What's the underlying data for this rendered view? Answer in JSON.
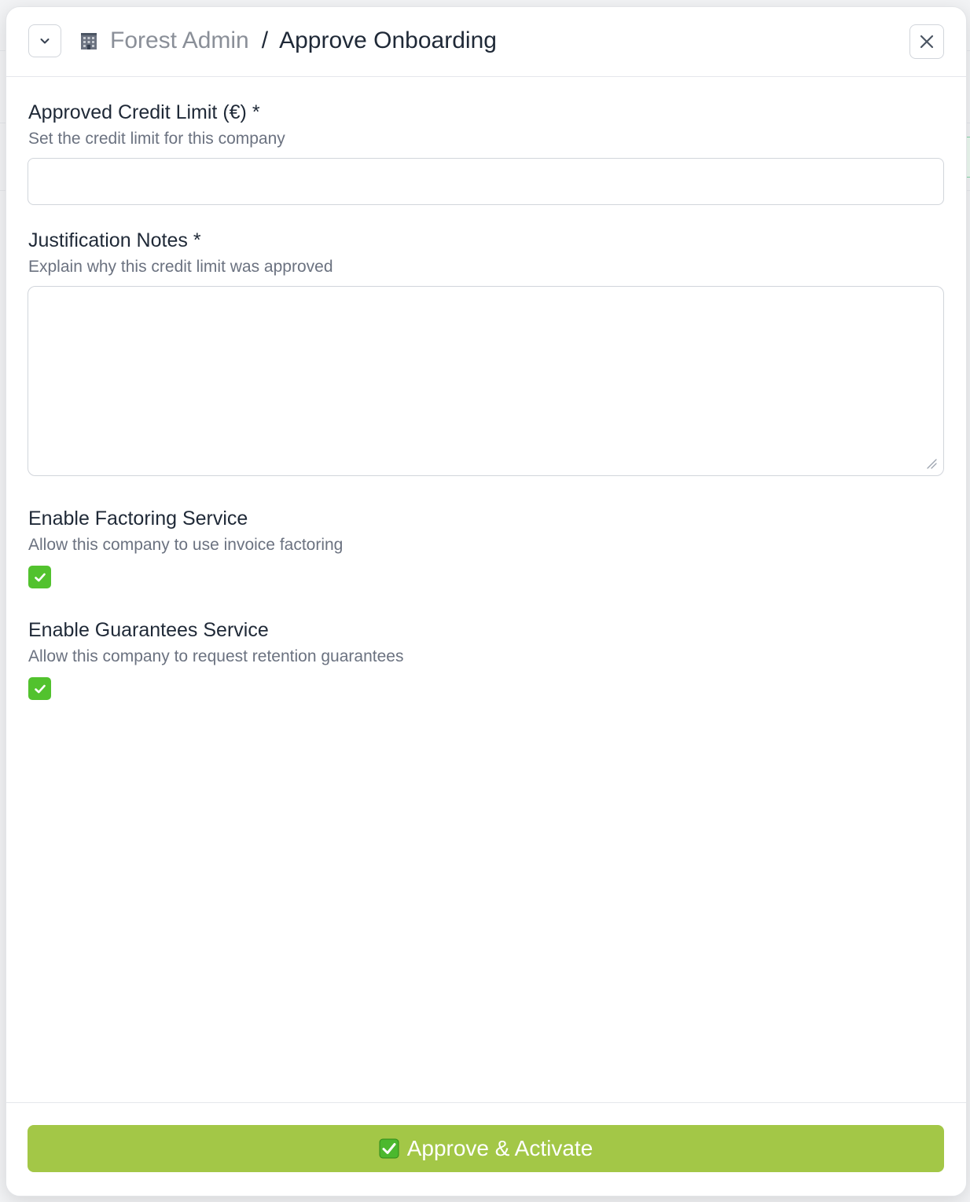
{
  "header": {
    "breadcrumb_root": "Forest Admin",
    "breadcrumb_separator": "/",
    "breadcrumb_current": "Approve Onboarding",
    "collapse_icon": "chevron-down-icon",
    "close_icon": "close-icon",
    "root_icon": "office-building-icon"
  },
  "form": {
    "credit_limit": {
      "label": "Approved Credit Limit (€) *",
      "help": "Set the credit limit for this company",
      "value": ""
    },
    "justification": {
      "label": "Justification Notes *",
      "help": "Explain why this credit limit was approved",
      "value": ""
    },
    "factoring": {
      "label": "Enable Factoring Service",
      "help": "Allow this company to use invoice factoring",
      "checked": true
    },
    "guarantees": {
      "label": "Enable Guarantees Service",
      "help": "Allow this company to request retention guarantees",
      "checked": true
    }
  },
  "footer": {
    "submit_label": "Approve & Activate",
    "submit_icon": "check-mark-button-icon"
  },
  "colors": {
    "submit_bg": "#a3c747",
    "checkbox_bg": "#52c22e"
  }
}
